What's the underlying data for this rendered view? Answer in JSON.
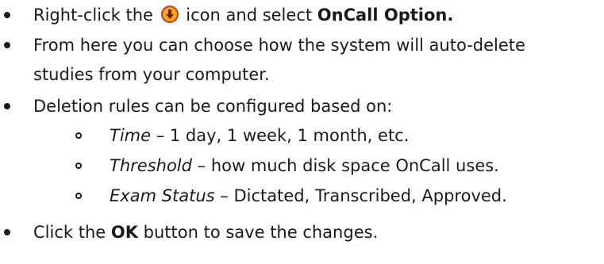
{
  "bullets": [
    {
      "before": "Right-click the ",
      "icon": "oncall-download-icon",
      "after": " icon and select ",
      "bold": "OnCall Option."
    },
    {
      "line1": "From here you can choose how the system will auto-delete",
      "line2": "studies from your computer."
    },
    {
      "text": "Deletion rules can be configured based on:",
      "subitems": [
        {
          "label": "Time",
          "text": " – 1 day, 1 week, 1 month, etc."
        },
        {
          "label": "Threshold",
          "text": " – how much disk space OnCall uses."
        },
        {
          "label": "Exam Status",
          "text": " – Dictated, Transcribed, Approved."
        }
      ]
    },
    {
      "before": "Click the ",
      "bold": "OK",
      "after": " button to save the changes."
    }
  ],
  "colors": {
    "text": "#1a1a1a",
    "icon_fill": "#f2a81d",
    "icon_ring": "#c0392b",
    "icon_arrow": "#7a1f12"
  }
}
